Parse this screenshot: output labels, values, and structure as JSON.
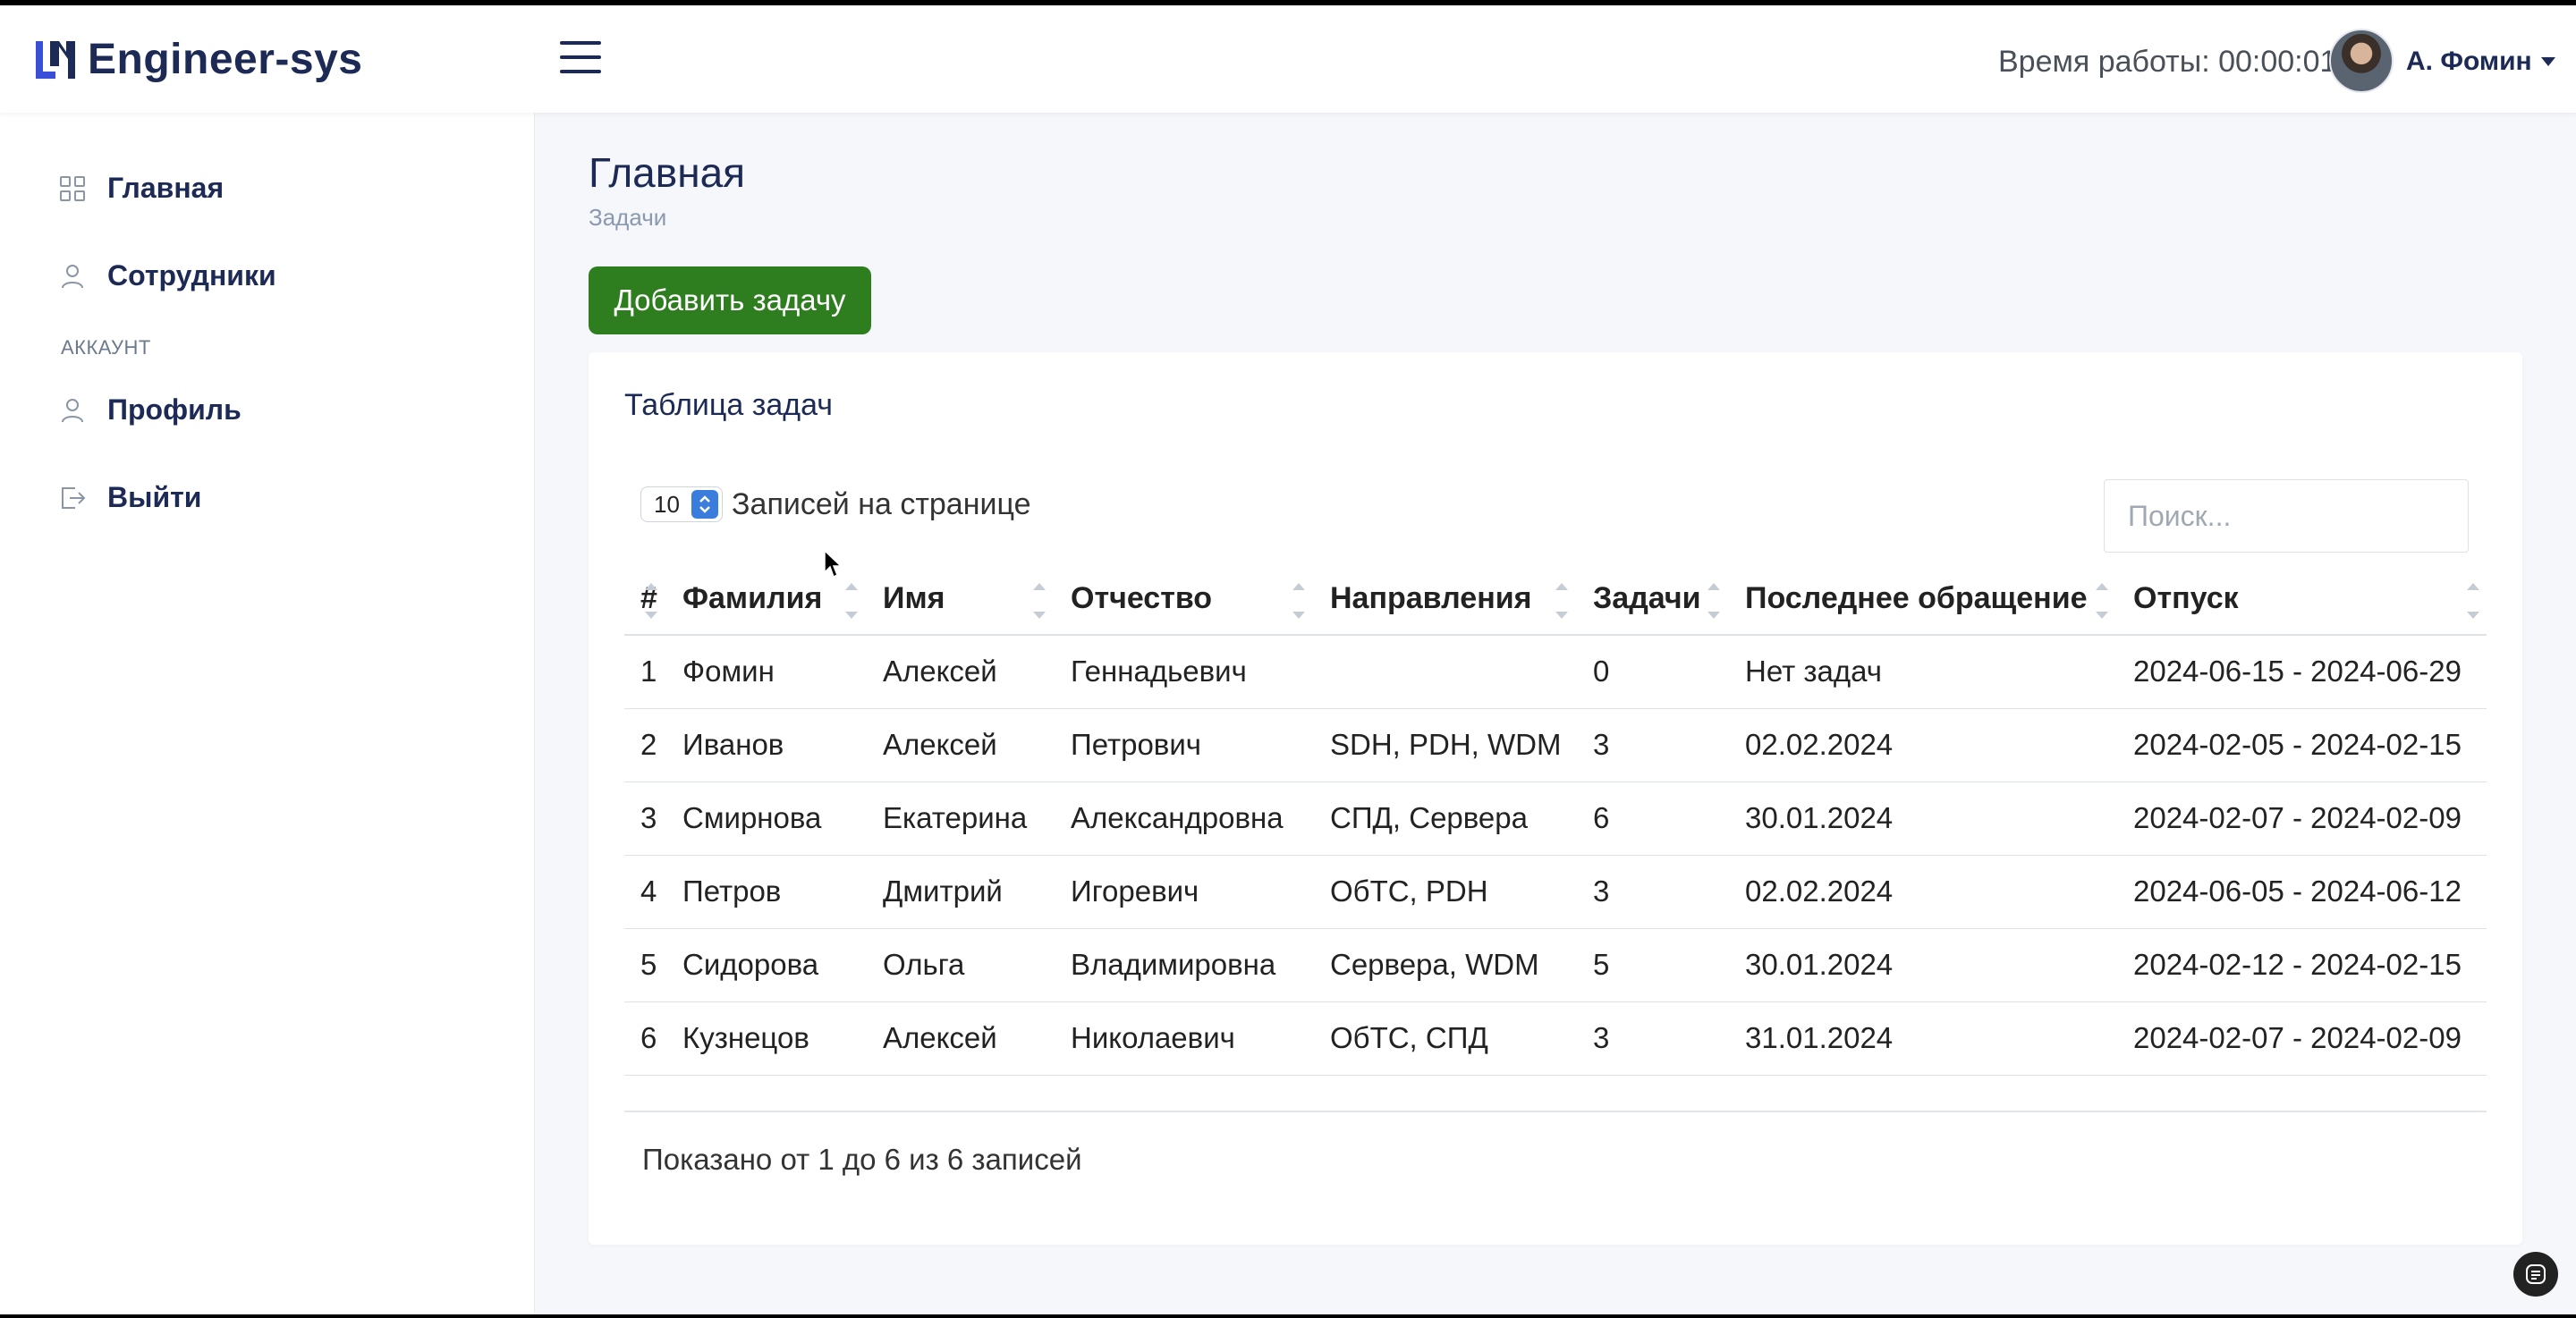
{
  "brand": {
    "name": "Engineer-sys",
    "logo_icon": "engineer-sys-logo-icon"
  },
  "header": {
    "menu_icon": "hamburger-menu-icon",
    "worktime": "Время работы: 00:00:01",
    "user_name": "А. Фомин"
  },
  "sidebar": {
    "items": [
      {
        "label": "Главная",
        "icon": "grid-icon"
      },
      {
        "label": "Сотрудники",
        "icon": "user-icon"
      }
    ],
    "section_header": "АККАУНТ",
    "account_items": [
      {
        "label": "Профиль",
        "icon": "user-icon"
      },
      {
        "label": "Выйти",
        "icon": "logout-icon"
      }
    ]
  },
  "page": {
    "title": "Главная",
    "breadcrumb": "Задачи",
    "add_button": "Добавить задачу"
  },
  "card": {
    "title": "Таблица задач",
    "page_length": "10",
    "page_length_label": "Записей на странице",
    "search_placeholder": "Поиск..."
  },
  "table": {
    "columns": [
      "#",
      "Фамилия",
      "Имя",
      "Отчество",
      "Направления",
      "Задачи",
      "Последнее обращение",
      "Отпуск"
    ],
    "rows": [
      [
        "1",
        "Фомин",
        "Алексей",
        "Геннадьевич",
        "",
        "0",
        "Нет задач",
        "2024-06-15 - 2024-06-29"
      ],
      [
        "2",
        "Иванов",
        "Алексей",
        "Петрович",
        "SDH, PDH, WDM",
        "3",
        "02.02.2024",
        "2024-02-05 - 2024-02-15"
      ],
      [
        "3",
        "Смирнова",
        "Екатерина",
        "Александровна",
        "СПД, Сервера",
        "6",
        "30.01.2024",
        "2024-02-07 - 2024-02-09"
      ],
      [
        "4",
        "Петров",
        "Дмитрий",
        "Игоревич",
        "ОбТС, PDH",
        "3",
        "02.02.2024",
        "2024-06-05 - 2024-06-12"
      ],
      [
        "5",
        "Сидорова",
        "Ольга",
        "Владимировна",
        "Сервера, WDM",
        "5",
        "30.01.2024",
        "2024-02-12 - 2024-02-15"
      ],
      [
        "6",
        "Кузнецов",
        "Алексей",
        "Николаевич",
        "ОбТС, СПД",
        "3",
        "31.01.2024",
        "2024-02-07 - 2024-02-09"
      ]
    ],
    "info": "Показано от 1 до 6 из 6 записей"
  },
  "colors": {
    "brand_dark": "#1c2a55",
    "accent_blue": "#3b7ddd",
    "add_button_green": "#2e7d1f"
  }
}
